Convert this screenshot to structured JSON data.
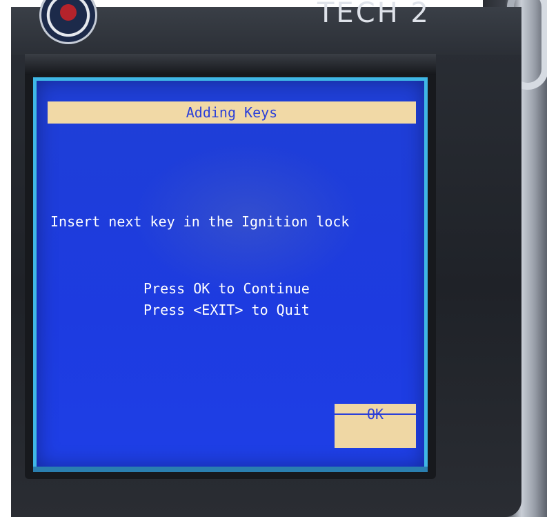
{
  "device": {
    "title": "TECH 2"
  },
  "screen": {
    "title": "Adding Keys",
    "instruction": "Insert next key in the Ignition lock",
    "prompt_ok": "Press OK to Continue",
    "prompt_exit": "Press <EXIT> to Quit",
    "softkey_ok": "OK"
  },
  "colors": {
    "screen_background": "#1f3fd6",
    "title_bar": "#f1d9a6",
    "title_text": "#2b3fd9",
    "body_text": "#ffffff",
    "softkey_background": "#efd7a4"
  }
}
